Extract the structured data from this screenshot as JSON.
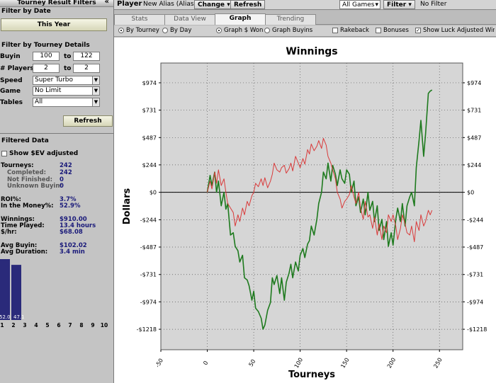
{
  "left_panel": {
    "title": "Tourney Result Filters",
    "collapse_glyph": "«",
    "filter_by_date": "Filter by Date",
    "date_button": "This Year",
    "filter_by_details": "Filter by Tourney Details",
    "buyin_label": "Buyin",
    "buyin_min": "100",
    "buyin_max": "122",
    "players_label": "# Players",
    "players_min": "2",
    "players_max": "2",
    "to_label": "to",
    "speed_label": "Speed",
    "speed_value": "Super Turbo",
    "game_label": "Game",
    "game_value": "No Limit",
    "tables_label": "Tables",
    "tables_value": "All",
    "refresh_button": "Refresh",
    "filtered_data": "Filtered Data",
    "show_sev": "Show $EV adjusted",
    "stats": [
      {
        "k": "Tourneys:",
        "v": "242",
        "sub": false,
        "y": 229
      },
      {
        "k": "Completed:",
        "v": "242",
        "sub": true,
        "y": 239
      },
      {
        "k": "Not Finished:",
        "v": "0",
        "sub": true,
        "y": 249
      },
      {
        "k": "Unknown Buyin:",
        "v": "0",
        "sub": true,
        "y": 258
      },
      {
        "k": "ROI%:",
        "v": "3.7%",
        "sub": false,
        "y": 277
      },
      {
        "k": "In the Money%:",
        "v": "52.9%",
        "sub": false,
        "y": 286
      },
      {
        "k": "Winnings:",
        "v": "$910.00",
        "sub": false,
        "y": 305
      },
      {
        "k": "Time Played:",
        "v": "13.4 hours",
        "sub": false,
        "y": 314
      },
      {
        "k": "$/hr:",
        "v": "$68.08",
        "sub": false,
        "y": 323
      },
      {
        "k": "Avg Buyin:",
        "v": "$102.02",
        "sub": false,
        "y": 342
      },
      {
        "k": "Avg Duration:",
        "v": "3.4 min",
        "sub": false,
        "y": 351
      }
    ],
    "histogram": {
      "bar_labels": [
        "52.0",
        "47.1"
      ],
      "values": [
        52.0,
        47.1
      ],
      "axis_labels": [
        "1",
        "2",
        "3",
        "4",
        "5",
        "6",
        "7",
        "8",
        "9",
        "10"
      ],
      "color": "#2a2a7a"
    }
  },
  "topbar": {
    "player_label": "Player",
    "alias": "New Alias (Alias)",
    "change_button": "Change",
    "refresh_button": "Refresh",
    "games_select": "All Games",
    "filter_button": "Filter",
    "no_filter": "No Filter"
  },
  "tabs": [
    {
      "label": "Stats",
      "active": false
    },
    {
      "label": "Data View",
      "active": false
    },
    {
      "label": "Graph",
      "active": true
    },
    {
      "label": "Trending",
      "active": false
    }
  ],
  "options": {
    "by_tourney": "By Tourney",
    "by_day": "By Day",
    "graph_won": "Graph $ Won",
    "graph_buyins": "Graph Buyins",
    "rakeback": "Rakeback",
    "bonuses": "Bonuses",
    "show_luck": "Show Luck Adjusted Winnings"
  },
  "chart_data": {
    "type": "line",
    "title": "Winnings",
    "xlabel": "Tourneys",
    "ylabel": "Dollars",
    "xlim": [
      -50,
      275
    ],
    "ylim": [
      -1400,
      1150
    ],
    "x_ticks": [
      -50,
      0,
      50,
      100,
      150,
      200,
      250
    ],
    "y_ticks": [
      974,
      731,
      487,
      244,
      0,
      -244,
      -487,
      -731,
      -974,
      -1218
    ],
    "y_tick_labels": [
      "$974",
      "$731",
      "$487",
      "$244",
      "$0",
      "-$244",
      "-$487",
      "-$731",
      "-$974",
      "-$1218"
    ],
    "grid": true,
    "zero_line": true,
    "series": [
      {
        "color": "#1e7a1e",
        "x": [
          0,
          3,
          5,
          8,
          10,
          12,
          15,
          18,
          20,
          22,
          25,
          28,
          30,
          33,
          35,
          38,
          40,
          43,
          45,
          48,
          50,
          52,
          55,
          58,
          60,
          62,
          65,
          68,
          70,
          72,
          75,
          78,
          80,
          83,
          85,
          88,
          90,
          92,
          95,
          98,
          100,
          103,
          105,
          108,
          110,
          112,
          115,
          118,
          120,
          123,
          125,
          128,
          130,
          133,
          135,
          138,
          140,
          143,
          145,
          148,
          150,
          153,
          155,
          158,
          160,
          163,
          165,
          168,
          170,
          173,
          175,
          178,
          180,
          183,
          185,
          188,
          190,
          193,
          195,
          198,
          200,
          203,
          205,
          208,
          210,
          213,
          215,
          218,
          220,
          223,
          225,
          228,
          230,
          233,
          235,
          238,
          240,
          242
        ],
        "y": [
          0,
          150,
          60,
          180,
          0,
          100,
          -120,
          0,
          -150,
          -100,
          -380,
          -360,
          -480,
          -520,
          -620,
          -560,
          -760,
          -780,
          -830,
          -960,
          -880,
          -1030,
          -1060,
          -1120,
          -1218,
          -1180,
          -1050,
          -980,
          -760,
          -820,
          -740,
          -900,
          -760,
          -960,
          -800,
          -720,
          -640,
          -760,
          -620,
          -700,
          -560,
          -500,
          -580,
          -460,
          -430,
          -300,
          -380,
          -240,
          -100,
          0,
          180,
          120,
          260,
          100,
          240,
          160,
          60,
          200,
          120,
          80,
          200,
          160,
          0,
          100,
          -120,
          -40,
          -180,
          -60,
          -200,
          0,
          -160,
          -80,
          -260,
          -120,
          -340,
          -240,
          -420,
          -260,
          -480,
          -360,
          -470,
          -240,
          -140,
          -260,
          -100,
          -300,
          -120,
          -40,
          0,
          -120,
          220,
          460,
          640,
          320,
          520,
          880,
          900,
          910
        ]
      },
      {
        "color": "#d93a3a",
        "x": [
          0,
          3,
          5,
          8,
          10,
          12,
          15,
          18,
          20,
          22,
          25,
          28,
          30,
          33,
          35,
          38,
          40,
          43,
          45,
          48,
          50,
          52,
          55,
          58,
          60,
          62,
          65,
          68,
          70,
          72,
          75,
          78,
          80,
          83,
          85,
          88,
          90,
          92,
          95,
          98,
          100,
          103,
          105,
          108,
          110,
          112,
          115,
          118,
          120,
          123,
          125,
          128,
          130,
          133,
          135,
          138,
          140,
          143,
          145,
          148,
          150,
          153,
          155,
          158,
          160,
          163,
          165,
          168,
          170,
          173,
          175,
          178,
          180,
          183,
          185,
          188,
          190,
          193,
          195,
          198,
          200,
          203,
          205,
          208,
          210,
          213,
          215,
          218,
          220,
          223,
          225,
          228,
          230,
          233,
          235,
          238,
          240,
          242
        ],
        "y": [
          0,
          100,
          30,
          180,
          80,
          200,
          60,
          120,
          0,
          -100,
          -140,
          -180,
          -300,
          -200,
          -260,
          -140,
          -200,
          -80,
          -120,
          -30,
          0,
          80,
          50,
          120,
          60,
          130,
          40,
          100,
          160,
          260,
          200,
          180,
          220,
          240,
          170,
          210,
          260,
          190,
          320,
          260,
          220,
          300,
          250,
          380,
          340,
          430,
          370,
          410,
          460,
          390,
          480,
          420,
          320,
          260,
          200,
          120,
          0,
          -60,
          -140,
          -80,
          -60,
          -20,
          60,
          -40,
          -100,
          0,
          -140,
          -240,
          -80,
          -220,
          -200,
          -320,
          -220,
          -380,
          -280,
          -420,
          -300,
          -360,
          -200,
          -260,
          -200,
          -300,
          -420,
          -320,
          -200,
          -280,
          -360,
          -380,
          -300,
          -440,
          -260,
          -340,
          -200,
          -300,
          -260,
          -160,
          -200,
          -160
        ]
      }
    ]
  }
}
